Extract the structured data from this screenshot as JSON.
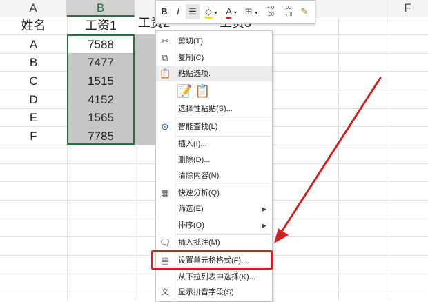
{
  "columns": [
    {
      "letter": "A"
    },
    {
      "letter": "B"
    },
    {
      "letter": "F"
    }
  ],
  "table": {
    "headers": [
      "姓名",
      "工资1",
      "工资2",
      "工资3"
    ],
    "rows": [
      {
        "name": "A",
        "salary1": "7588"
      },
      {
        "name": "B",
        "salary1": "7477"
      },
      {
        "name": "C",
        "salary1": "1515"
      },
      {
        "name": "D",
        "salary1": "4152"
      },
      {
        "name": "E",
        "salary1": "1565"
      },
      {
        "name": "F",
        "salary1": "7785"
      }
    ]
  },
  "mini_toolbar": {
    "bold": "B",
    "italic": "I",
    "font_color": "A",
    "decimal_increase": "+.0\n.00",
    "decimal_decrease": ".00\n→.0"
  },
  "context_menu": {
    "items": [
      {
        "label": "剪切(T)",
        "icon": "scissors-icon"
      },
      {
        "label": "复制(C)",
        "icon": "copy-icon"
      },
      {
        "label": "粘贴选项:",
        "icon": "paste-icon"
      },
      {
        "label": "选择性粘贴(S)...",
        "icon": ""
      },
      {
        "label": "智能查找(L)",
        "icon": "smart-lookup-icon"
      },
      {
        "label": "插入(I)...",
        "icon": ""
      },
      {
        "label": "删除(D)...",
        "icon": ""
      },
      {
        "label": "清除内容(N)",
        "icon": ""
      },
      {
        "label": "快速分析(Q)",
        "icon": "quick-analysis-icon"
      },
      {
        "label": "筛选(E)",
        "icon": "",
        "submenu": true
      },
      {
        "label": "排序(O)",
        "icon": "",
        "submenu": true
      },
      {
        "label": "插入批注(M)",
        "icon": "comment-icon"
      },
      {
        "label": "设置单元格格式(F)...",
        "icon": "format-cells-icon"
      },
      {
        "label": "从下拉列表中选择(K)...",
        "icon": ""
      },
      {
        "label": "显示拼音字段(S)",
        "icon": "phonetic-icon"
      }
    ],
    "highlighted": "设置单元格格式(F)..."
  },
  "colors": {
    "accent_green": "#217346",
    "annotation_red": "#d21f1f",
    "selection_gray": "#c6c6c6"
  }
}
